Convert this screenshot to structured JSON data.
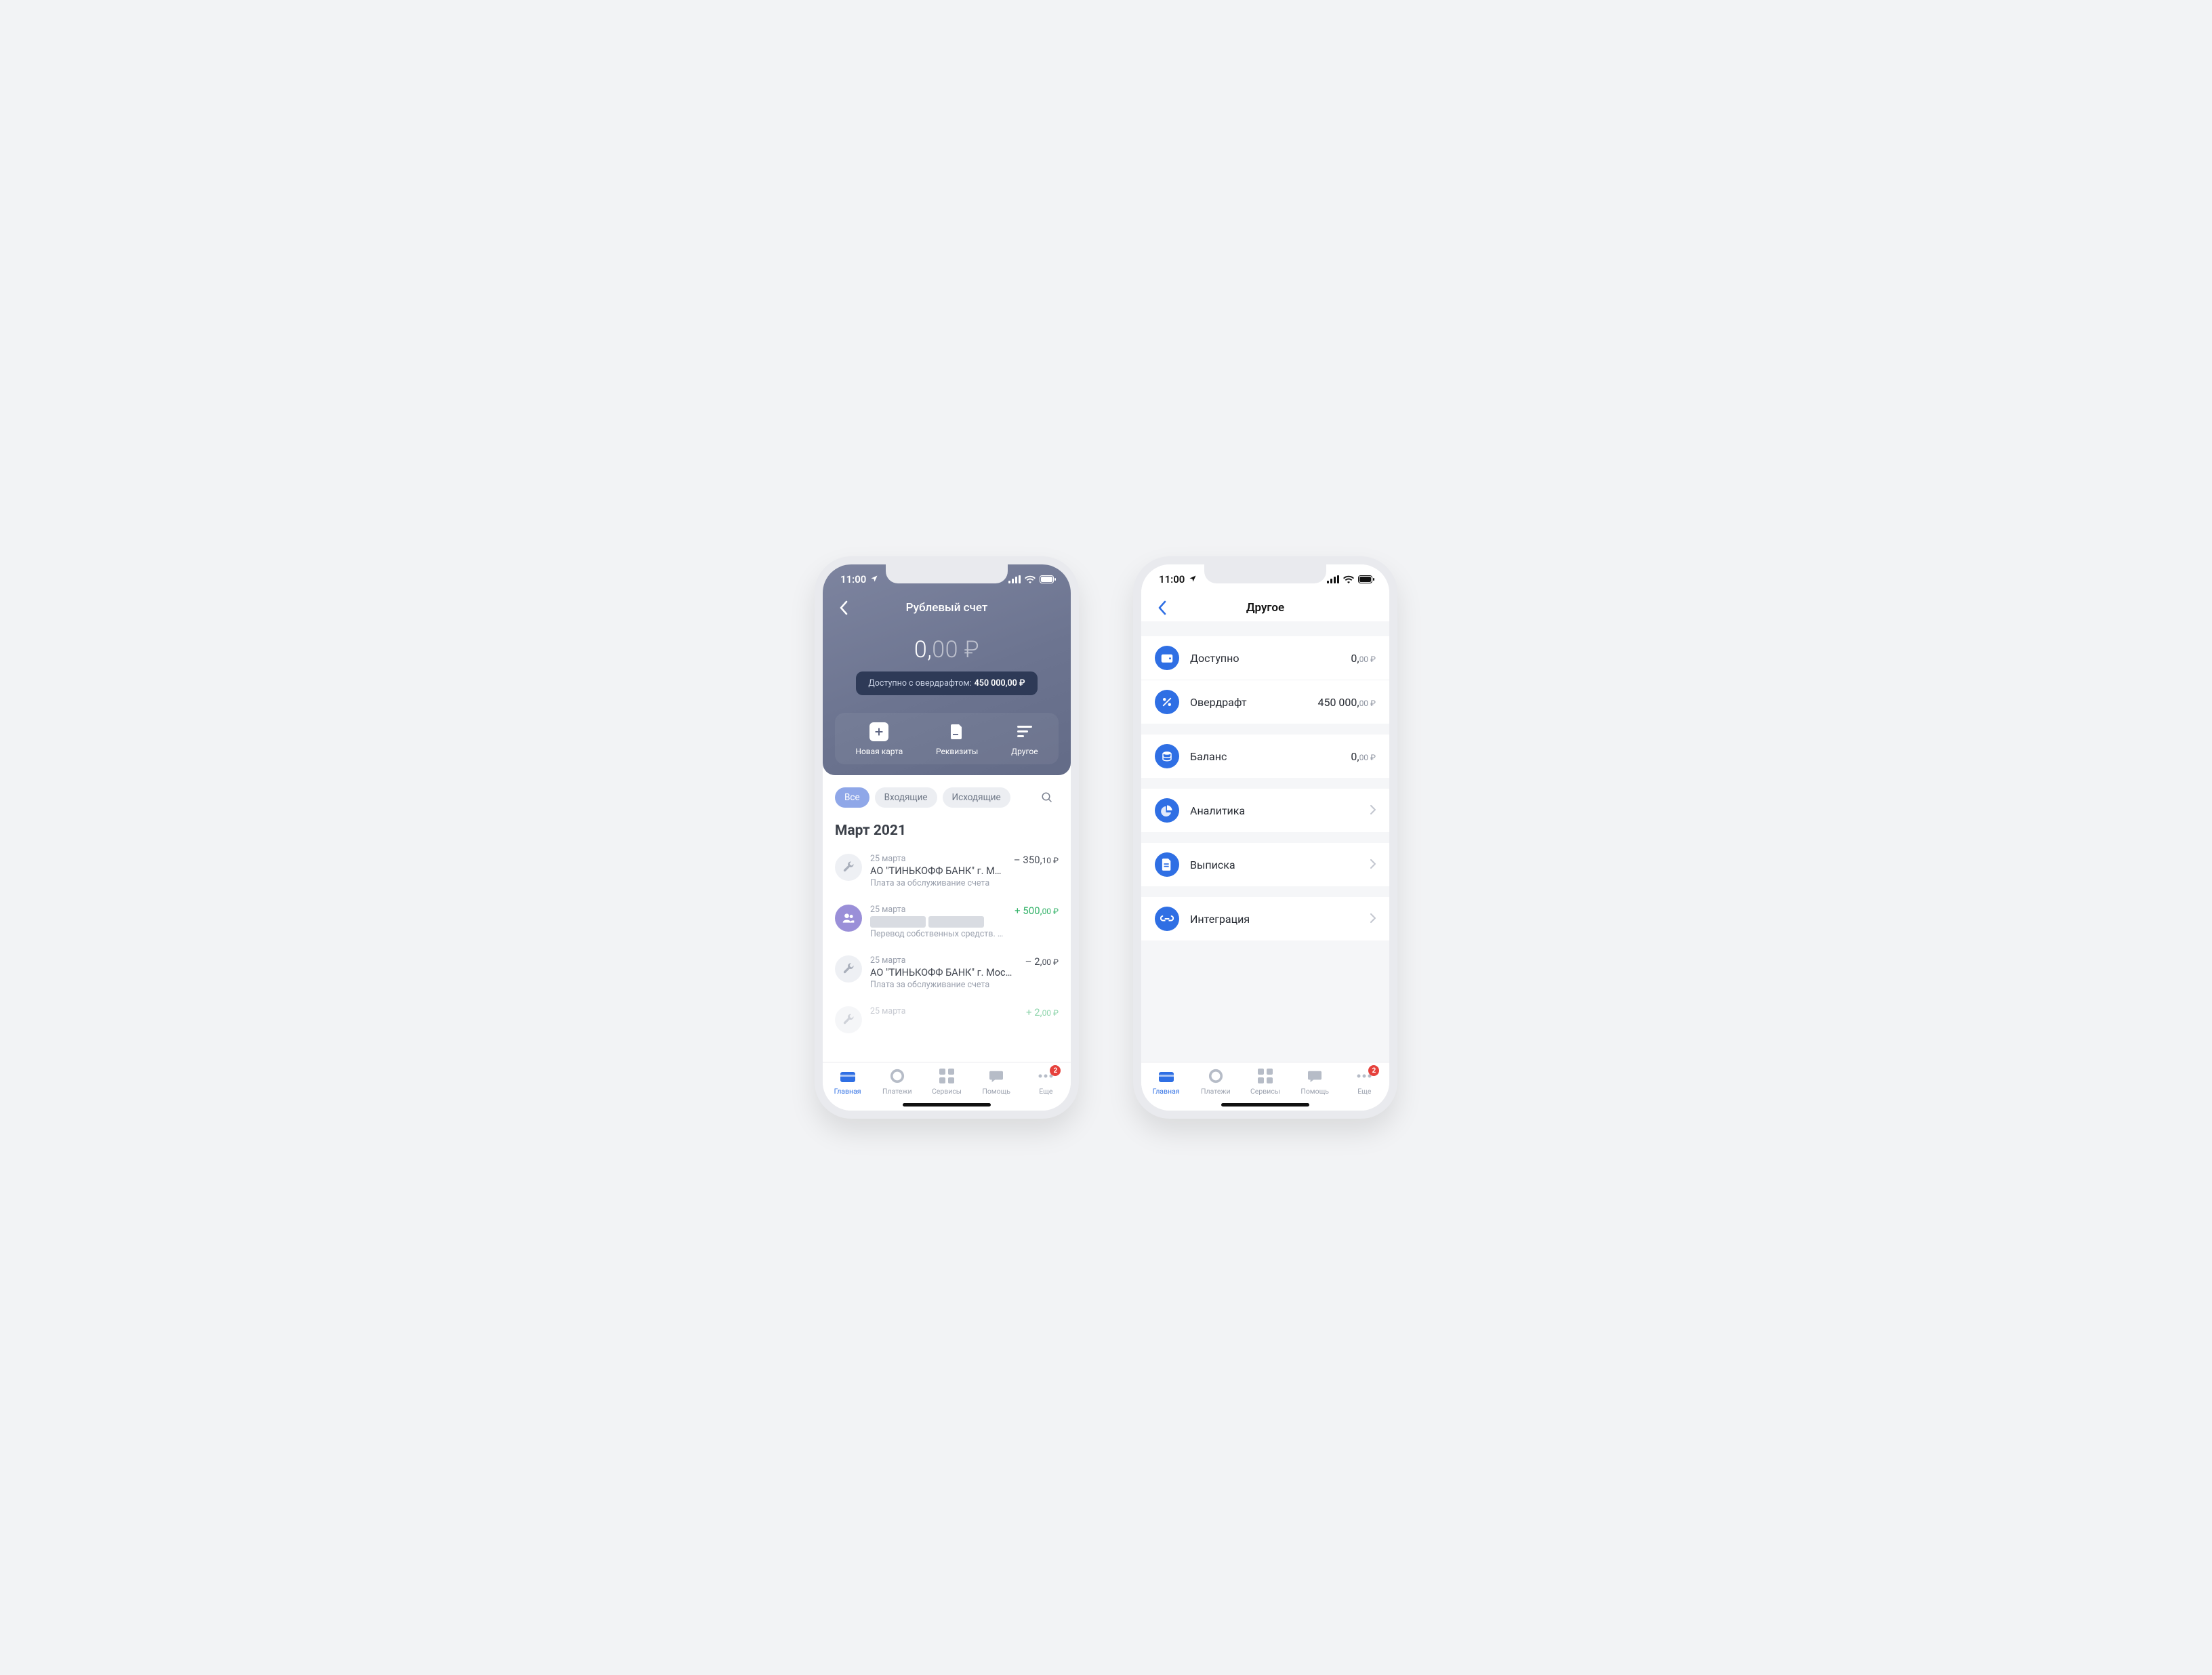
{
  "status": {
    "time": "11:00"
  },
  "phone1": {
    "title": "Рублевый счет",
    "balance_int": "0,",
    "balance_frac": "00 ₽",
    "overdraft_label": "Доступно с овердрафтом:",
    "overdraft_value": "450 000,00 ₽",
    "actions": [
      {
        "label": "Новая карта"
      },
      {
        "label": "Реквизиты"
      },
      {
        "label": "Другое"
      }
    ],
    "chips": [
      {
        "label": "Все",
        "active": true
      },
      {
        "label": "Входящие",
        "active": false
      },
      {
        "label": "Исходящие",
        "active": false
      }
    ],
    "month": "Март 2021",
    "tx": [
      {
        "date": "25 марта",
        "name": "АО \"ТИНЬКОФФ БАНК\" г. Москва",
        "desc": "Плата за обслуживание счета",
        "amount_int": "– 350,",
        "amount_frac": "10 ₽",
        "pos": false,
        "icon": "wrench",
        "redacted": false
      },
      {
        "date": "25 марта",
        "name": "████████ ████████",
        "desc": "Перевод собственных средств. НДС не обл…",
        "amount_int": "+ 500,",
        "amount_frac": "00 ₽",
        "pos": true,
        "icon": "people",
        "redacted": true
      },
      {
        "date": "25 марта",
        "name": "АО \"ТИНЬКОФФ БАНК\" г. Москва",
        "desc": "Плата за обслуживание счета",
        "amount_int": "– 2,",
        "amount_frac": "00 ₽",
        "pos": false,
        "icon": "wrench",
        "redacted": false
      },
      {
        "date": "25 марта",
        "name": "",
        "desc": "",
        "amount_int": "+ 2,",
        "amount_frac": "00 ₽",
        "pos": true,
        "icon": "wrench",
        "redacted": false
      }
    ]
  },
  "phone2": {
    "title": "Другое",
    "available_label": "Доступно",
    "available_int": "0,",
    "available_frac": "00 ₽",
    "overdraft_label": "Овердрафт",
    "overdraft_int": "450 000,",
    "overdraft_frac": "00 ₽",
    "balance_label": "Баланс",
    "balance_int": "0,",
    "balance_frac": "00 ₽",
    "nav": [
      {
        "label": "Аналитика",
        "icon": "pie"
      },
      {
        "label": "Выписка",
        "icon": "doc"
      },
      {
        "label": "Интеграция",
        "icon": "link"
      }
    ]
  },
  "tabs": [
    {
      "label": "Главная",
      "active": true
    },
    {
      "label": "Платежи",
      "active": false
    },
    {
      "label": "Сервисы",
      "active": false
    },
    {
      "label": "Помощь",
      "active": false
    },
    {
      "label": "Еще",
      "active": false,
      "badge": "2"
    }
  ]
}
